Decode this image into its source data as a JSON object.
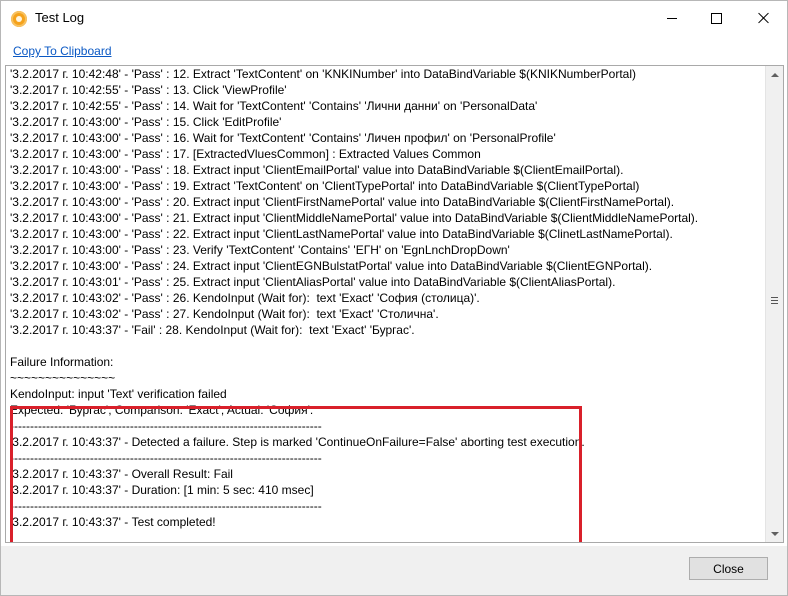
{
  "window": {
    "title": "Test Log"
  },
  "toolbar": {
    "copy_label": "Copy To Clipboard"
  },
  "log": {
    "lines": [
      "'3.2.2017 г. 10:42:48' - 'Pass' : 12. Extract 'TextContent' on 'KNKINumber' into DataBindVariable $(KNIKNumberPortal)",
      "'3.2.2017 г. 10:42:55' - 'Pass' : 13. Click 'ViewProfile'",
      "'3.2.2017 г. 10:42:55' - 'Pass' : 14. Wait for 'TextContent' 'Contains' 'Лични данни' on 'PersonalData'",
      "'3.2.2017 г. 10:43:00' - 'Pass' : 15. Click 'EditProfile'",
      "'3.2.2017 г. 10:43:00' - 'Pass' : 16. Wait for 'TextContent' 'Contains' 'Личен профил' on 'PersonalProfile'",
      "'3.2.2017 г. 10:43:00' - 'Pass' : 17. [ExtractedVluesCommon] : Extracted Values Common",
      "'3.2.2017 г. 10:43:00' - 'Pass' : 18. Extract input 'ClientEmailPortal' value into DataBindVariable $(ClientEmailPortal).",
      "'3.2.2017 г. 10:43:00' - 'Pass' : 19. Extract 'TextContent' on 'ClientTypePortal' into DataBindVariable $(ClientTypePortal)",
      "'3.2.2017 г. 10:43:00' - 'Pass' : 20. Extract input 'ClientFirstNamePortal' value into DataBindVariable $(ClientFirstNamePortal).",
      "'3.2.2017 г. 10:43:00' - 'Pass' : 21. Extract input 'ClientMiddleNamePortal' value into DataBindVariable $(ClientMiddleNamePortal).",
      "'3.2.2017 г. 10:43:00' - 'Pass' : 22. Extract input 'ClientLastNamePortal' value into DataBindVariable $(ClinetLastNamePortal).",
      "'3.2.2017 г. 10:43:00' - 'Pass' : 23. Verify 'TextContent' 'Contains' 'ЕГН' on 'EgnLnchDropDown'",
      "'3.2.2017 г. 10:43:00' - 'Pass' : 24. Extract input 'ClientEGNBulstatPortal' value into DataBindVariable $(ClientEGNPortal).",
      "'3.2.2017 г. 10:43:01' - 'Pass' : 25. Extract input 'ClientAliasPortal' value into DataBindVariable $(ClientAliasPortal).",
      "'3.2.2017 г. 10:43:02' - 'Pass' : 26. KendoInput (Wait for):  text 'Exact' 'София (столица)'.",
      "'3.2.2017 г. 10:43:02' - 'Pass' : 27. KendoInput (Wait for):  text 'Exact' 'Столична'.",
      "'3.2.2017 г. 10:43:37' - 'Fail' : 28. KendoInput (Wait for):  text 'Exact' 'Бургас'.",
      "",
      "Failure Information:",
      "~~~~~~~~~~~~~~~",
      "KendoInput: input 'Text' verification failed",
      "Expected: 'Бургас', Comparison: 'Exact', Actual: 'София'.",
      "------------------------------------------------------------------------------",
      "'3.2.2017 г. 10:43:37' - Detected a failure. Step is marked 'ContinueOnFailure=False' aborting test execution.",
      "------------------------------------------------------------------------------",
      "'3.2.2017 г. 10:43:37' - Overall Result: Fail",
      "'3.2.2017 г. 10:43:37' - Duration: [1 min: 5 sec: 410 msec]",
      "------------------------------------------------------------------------------",
      "'3.2.2017 г. 10:43:37' - Test completed!"
    ]
  },
  "footer": {
    "close_label": "Close"
  },
  "colors": {
    "link": "#0a58c4",
    "highlight_border": "#d9202a",
    "app_icon": "#f5a21b"
  },
  "icons": [
    "app-icon",
    "minimize-icon",
    "maximize-icon",
    "close-icon",
    "scroll-up-arrow-icon",
    "scroll-down-arrow-icon",
    "scroll-grip-icon"
  ]
}
